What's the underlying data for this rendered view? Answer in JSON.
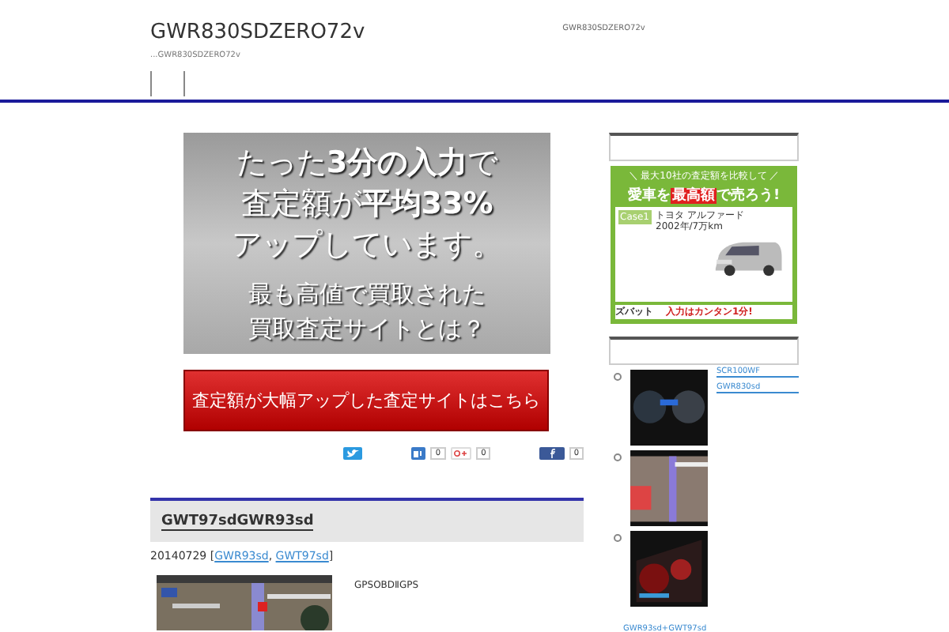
{
  "header": {
    "title": "GWR830SDZERO72v",
    "tagline": "...GWR830SDZERO72v",
    "center_text": "GWR830SDZERO72v"
  },
  "banner": {
    "lines": [
      {
        "text": "たった**3分の入力**で",
        "kind": "big"
      },
      {
        "text": "査定額が**平均33%**",
        "kind": "big"
      },
      {
        "text": "アップしています。",
        "kind": "big"
      },
      {
        "text": "最も高値で買取された",
        "kind": "small"
      },
      {
        "text": "買取査定サイトとは？",
        "kind": "small"
      }
    ]
  },
  "cta": {
    "label": "査定額が大幅アップした査定サイトはこちら"
  },
  "share": [
    {
      "kind": "twitter"
    },
    {
      "kind": "hatena",
      "count": "0"
    },
    {
      "kind": "gplus",
      "count": "0"
    },
    {
      "kind": "facebook",
      "count": "0"
    }
  ],
  "post": {
    "title": "GWT97sdGWR93sd",
    "date": "20140729",
    "tags_open": "[",
    "tags": [
      "GWR93sd",
      "GWT97sd"
    ],
    "tag_separator": ",",
    "tags_close": "]",
    "excerpt": "GPSOBDⅡGPS"
  },
  "ad": {
    "top": "＼ 最大10社の査定額を比較して ／",
    "headline_pre": "愛車を",
    "headline_mid": "最高額",
    "headline_post": "で売ろう!",
    "case": "Case1",
    "car": "トヨタ アルファード",
    "spec": "2002年/7万km",
    "brand": "ズバット",
    "footer": "入力はカンタン1分!"
  },
  "related": [
    {
      "links": [
        "SCR100WF",
        "GWR830sd"
      ],
      "kind": "gauge"
    },
    {
      "kind": "map"
    },
    {
      "kind": "red"
    }
  ],
  "related_footer": "GWR93sd+GWT97sd"
}
